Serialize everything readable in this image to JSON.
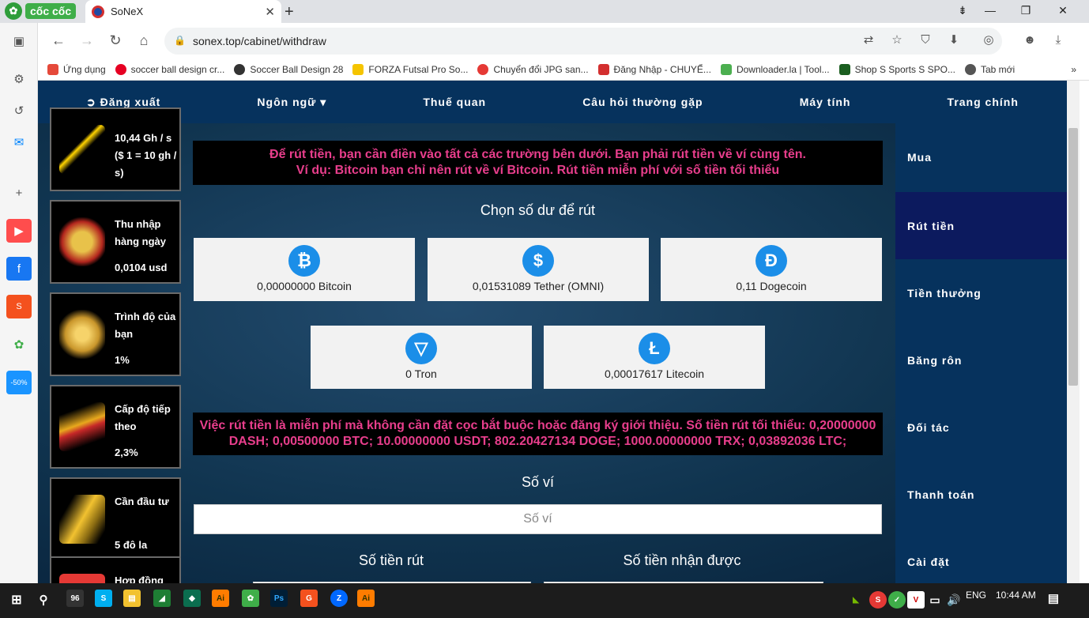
{
  "browser": {
    "brand": "cốc cốc",
    "tab_title": "SoNeX",
    "url": "sonex.top/cabinet/withdraw",
    "bookmarks": [
      {
        "label": "Ứng dụng",
        "icon": "apps-grid-icon",
        "color": "#e5493a"
      },
      {
        "label": "soccer ball design cr...",
        "icon": "pinterest-icon",
        "color": "#e60023"
      },
      {
        "label": "Soccer Ball Design 28",
        "icon": "soccer-ball-icon",
        "color": "#333333"
      },
      {
        "label": "FORZA Futsal Pro So...",
        "icon": "forza-icon",
        "color": "#111111"
      },
      {
        "label": "Chuyển đổi JPG san...",
        "icon": "convert-icon",
        "color": "#e53935"
      },
      {
        "label": "Đăng Nhập - CHUYỂ...",
        "icon": "bookmark-icon",
        "color": "#d32f2f"
      },
      {
        "label": "Downloader.la | Tool...",
        "icon": "dino-icon",
        "color": "#4caf50"
      },
      {
        "label": "Shop S Sports S SPO...",
        "icon": "shop-icon",
        "color": "#1b5e20"
      },
      {
        "label": "Tab mới",
        "icon": "globe-icon",
        "color": "#555555"
      }
    ]
  },
  "topnav": {
    "logout": "Đăng xuất",
    "language": "Ngôn ngữ",
    "tariffs": "Thuế quan",
    "faq": "Câu hỏi thường gặp",
    "calculator": "Máy tính",
    "home": "Trang chính"
  },
  "stats": [
    {
      "label": "10,44 Gh / s ($ 1 = 10 gh / s)",
      "value": ""
    },
    {
      "label": "Thu nhập hàng ngày",
      "value": "0,0104 usd"
    },
    {
      "label": "Trình độ của bạn",
      "value": "1%"
    },
    {
      "label": "Cấp độ tiếp theo",
      "value": "2,3%"
    },
    {
      "label": "Cần đầu tư",
      "value": "5 đô la"
    },
    {
      "label": "Hợp đồng",
      "value": ""
    }
  ],
  "main": {
    "notice_top_1": "Để rút tiền, bạn cần điền vào tất cả các trường bên dưới. Bạn phải rút tiền về ví cùng tên.",
    "notice_top_2": "Ví dụ: Bitcoin bạn chỉ nên rút về ví Bitcoin. Rút tiền miễn phí với số tiền tối thiểu",
    "choose_balance": "Chọn số dư để rút",
    "coins": [
      {
        "name": "0,00000000 Bitcoin",
        "symbol": "₿"
      },
      {
        "name": "0,01531089 Tether (OMNI)",
        "symbol": "$"
      },
      {
        "name": "0,11 Dogecoin",
        "symbol": "Ð"
      },
      {
        "name": "0 Tron",
        "symbol": "▽"
      },
      {
        "name": "0,00017617 Litecoin",
        "symbol": "Ł"
      }
    ],
    "notice_mid_1": "Việc rút tiền là miễn phí mà không cần đặt cọc bắt buộc hoặc đăng ký giới thiệu. Số tiền rút tối thiểu: 0,20000000",
    "notice_mid_2": "DASH; 0,00500000 BTC; 10.00000000 USDT; 802.20427134 DOGE; 1000.00000000 TRX; 0,03892036 LTC;",
    "wallet_heading": "Số ví",
    "wallet_placeholder": "Số ví",
    "amount_heading": "Số tiền rút",
    "receive_heading": "Số tiền nhận được"
  },
  "rightnav": [
    {
      "label": "Mua",
      "active": false
    },
    {
      "label": "Rút tiền",
      "active": true
    },
    {
      "label": "Tiền thưởng",
      "active": false
    },
    {
      "label": "Băng rôn",
      "active": false
    },
    {
      "label": "Đối tác",
      "active": false
    },
    {
      "label": "Thanh toán",
      "active": false
    },
    {
      "label": "Cài đặt",
      "active": false
    }
  ],
  "taskbar": {
    "time": "10:44 AM",
    "lang": "ENG"
  }
}
